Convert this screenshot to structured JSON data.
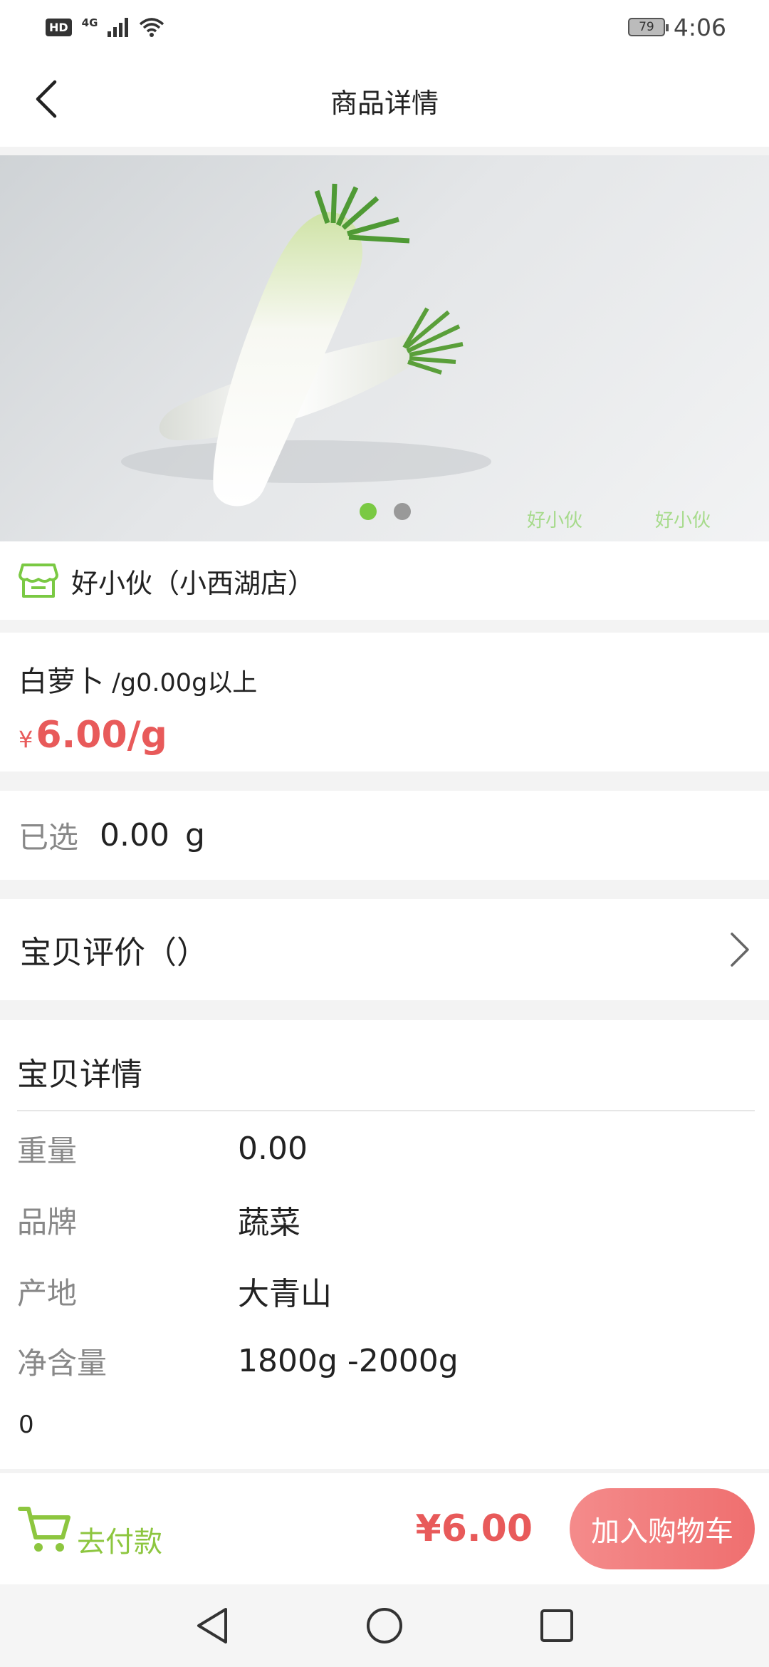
{
  "status_bar": {
    "hd": "HD",
    "network": "4G",
    "battery": "79",
    "time": "4:06"
  },
  "header": {
    "title": "商品详情",
    "back_icon": "chevron-left-icon"
  },
  "gallery": {
    "image_subject": "white-radish-photo",
    "page_count": 2,
    "active_page": 1,
    "watermarks": [
      "好小伙",
      "好小伙"
    ]
  },
  "store": {
    "icon": "store-icon",
    "name": "好小伙（小西湖店）"
  },
  "product": {
    "name": "白萝卜",
    "unit_text": " /g0.00g以上",
    "price_symbol": "¥",
    "price": "6.00/g"
  },
  "selected": {
    "label": "已选",
    "value": "0.00",
    "unit": "g"
  },
  "reviews": {
    "label": "宝贝评价（）",
    "arrow_icon": "chevron-right-icon"
  },
  "details": {
    "title": "宝贝详情",
    "specs": [
      {
        "label": "重量",
        "value": "0.00"
      },
      {
        "label": "品牌",
        "value": "蔬菜"
      },
      {
        "label": "产地",
        "value": "大青山"
      },
      {
        "label": "净含量",
        "value": "1800g -2000g"
      }
    ],
    "footnote": "0"
  },
  "action_bar": {
    "cart_icon": "cart-icon",
    "checkout_label": "去付款",
    "total": "¥6.00",
    "add_to_cart": "加入购物车"
  },
  "nav_bar": {
    "icons": [
      "back-triangle-icon",
      "home-circle-icon",
      "recents-square-icon"
    ]
  },
  "colors": {
    "accent_green": "#7ac943",
    "price_red": "#e85a5a",
    "button_red": "#ef6f6f"
  }
}
